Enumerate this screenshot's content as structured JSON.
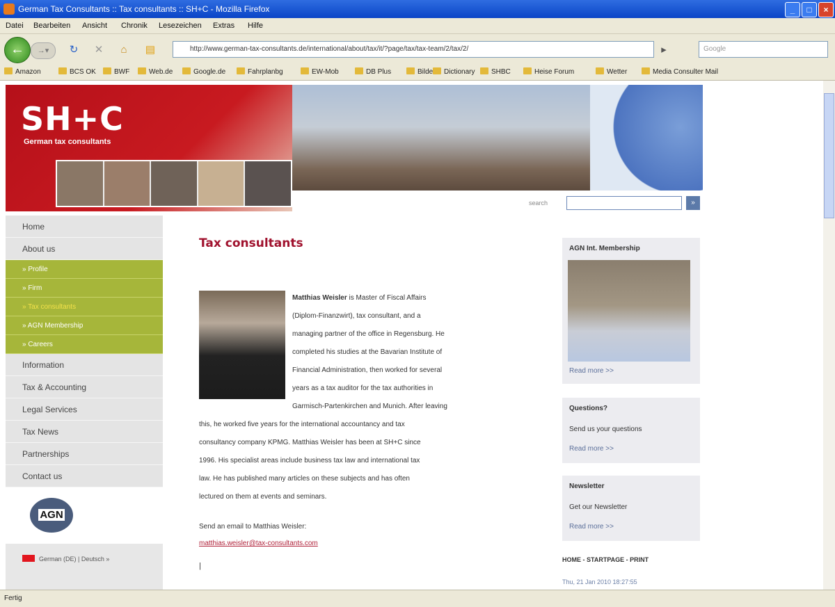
{
  "window": {
    "title": "German Tax Consultants :: Tax consultants :: SH+C - Mozilla Firefox"
  },
  "menu": [
    "Datei",
    "Bearbeiten",
    "Ansicht",
    "Chronik",
    "Lesezeichen",
    "Extras",
    "Hilfe"
  ],
  "browser": {
    "url": "http://www.german-tax-consultants.de/international/about/tax/it/?page/tax/tax-team/2/tax/2/",
    "search_placeholder": "Google"
  },
  "bookmarks": [
    "Amazon",
    "BCS OK",
    "BWF",
    "Web.de",
    "Google.de",
    "Fahrplanbg",
    "EW-Mob",
    "DB Plus",
    "Bilder",
    "Dictionary",
    "SHBC",
    "Heise Forum",
    "Wetter",
    "Media Consulter Mail"
  ],
  "status": "Fertig",
  "site": {
    "logo": "SH+C",
    "tagline": "German tax consultants",
    "search_label": "search",
    "search_go": "»",
    "nav": [
      {
        "label": "Home",
        "type": "item"
      },
      {
        "label": "About us",
        "type": "item"
      },
      {
        "label": "» Profile",
        "type": "sub"
      },
      {
        "label": "» Firm",
        "type": "sub"
      },
      {
        "label": "» Tax consultants",
        "type": "sub",
        "active": true
      },
      {
        "label": "» AGN Membership",
        "type": "sub"
      },
      {
        "label": "» Careers",
        "type": "sub"
      },
      {
        "label": "Information",
        "type": "item"
      },
      {
        "label": "Tax & Accounting",
        "type": "item"
      },
      {
        "label": "Legal Services",
        "type": "item"
      },
      {
        "label": "Tax News",
        "type": "item"
      },
      {
        "label": "Partnerships",
        "type": "item"
      },
      {
        "label": "Contact us",
        "type": "item"
      }
    ],
    "agn_logo": "AGN",
    "language": "German (DE) | Deutsch »",
    "main": {
      "title": "Tax consultants",
      "bio_name": "Matthias Weisler",
      "bio_lines": [
        " is Master of Fiscal Affairs",
        "(Diplom-Finanzwirt), tax consultant, and a",
        "managing partner of the office in Regensburg. He",
        "completed his studies at the Bavarian Institute of",
        "Financial Administration, then worked for several",
        "years as a tax auditor for the tax authorities in",
        "Garmisch-Partenkirchen and Munich. After leaving",
        "this, he worked five years for the international accountancy and tax",
        "consultancy company KPMG. Matthias Weisler has been at SH+C since",
        "1996. His specialist areas include business tax law and international tax",
        "law. He has published many articles on these subjects and has often",
        "lectured on them at events and seminars."
      ],
      "mail_intro": "Send an email to Matthias Weisler:",
      "mail_link": "matthias.weisler@tax-consultants.com"
    },
    "sidebar": {
      "box1_title": "AGN Int. Membership",
      "box1_more": "Read more >>",
      "box2_title": "Questions?",
      "box2_line": "Send us your questions",
      "box2_more": "Read more >>",
      "box3_title": "Newsletter",
      "box3_line": "Get our Newsletter",
      "box3_more": "Read more >>",
      "dates_line": "HOME - STARTPAGE - PRINT",
      "date": "Thu, 21 Jan 2010 18:27:55"
    }
  }
}
